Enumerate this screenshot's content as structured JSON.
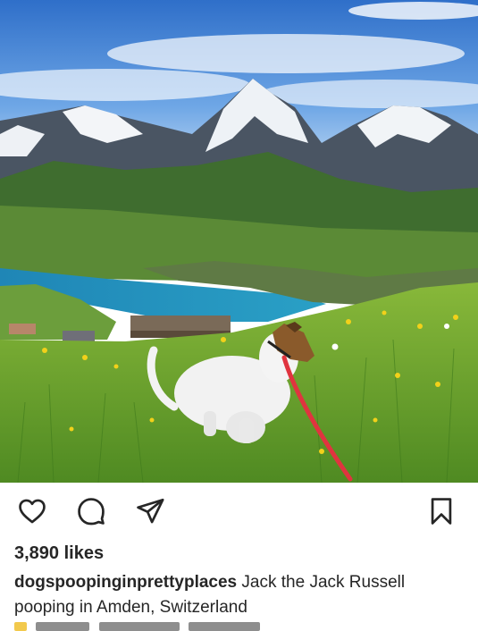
{
  "post": {
    "likes_text": "3,890 likes",
    "caption_user": "dogspoopinginprettyplaces",
    "caption_text": "Jack the Jack Russell pooping in Amden, Switzerland"
  },
  "icons": {
    "like": "heart-icon",
    "comment": "comment-icon",
    "share": "share-icon",
    "save": "bookmark-icon"
  },
  "colors": {
    "text": "#262626",
    "leash": "#e0343f",
    "lake": "#2a8fb8"
  }
}
